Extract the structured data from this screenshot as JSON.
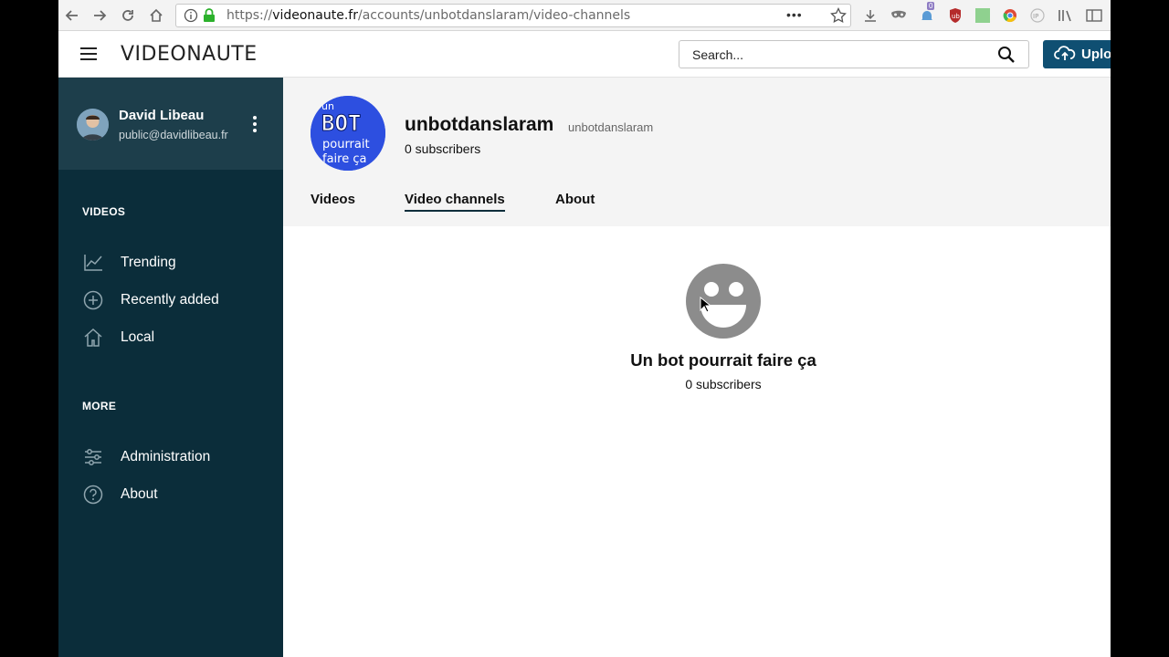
{
  "browser": {
    "url_prefix": "https://",
    "url_host": "videonaute.fr",
    "url_path": "/accounts/unbotdanslaram/video-channels",
    "more_label": "•••",
    "badge_count": "0"
  },
  "header": {
    "logo": "VIDEONAUTE",
    "search_placeholder": "Search...",
    "upload_label": "Uplo"
  },
  "sidebar": {
    "user": {
      "name": "David Libeau",
      "email": "public@davidlibeau.fr"
    },
    "sections": [
      {
        "title": "VIDEOS",
        "items": [
          {
            "label": "Trending",
            "icon": "trending-icon"
          },
          {
            "label": "Recently added",
            "icon": "plus-circle-icon"
          },
          {
            "label": "Local",
            "icon": "home-icon"
          }
        ]
      },
      {
        "title": "MORE",
        "items": [
          {
            "label": "Administration",
            "icon": "sliders-icon"
          },
          {
            "label": "About",
            "icon": "help-circle-icon"
          }
        ]
      }
    ]
  },
  "account": {
    "display_name": "unbotdanslaram",
    "handle": "unbotdanslaram",
    "subscribers": "0 subscribers",
    "avatar_text": {
      "line1": "un",
      "line2": "BOT",
      "line3": "pourrait",
      "line4": "faire ça"
    },
    "tabs": [
      {
        "label": "Videos",
        "active": false
      },
      {
        "label": "Video channels",
        "active": true
      },
      {
        "label": "About",
        "active": false
      }
    ]
  },
  "channel_card": {
    "title": "Un bot pourrait faire ça",
    "subscribers": "0 subscribers"
  },
  "colors": {
    "sidebar_bg": "#0b2d3a",
    "user_panel_bg": "#1d3e4b",
    "upload_bg": "#0f4f72",
    "channel_avatar_bg": "#2d4fe0"
  }
}
